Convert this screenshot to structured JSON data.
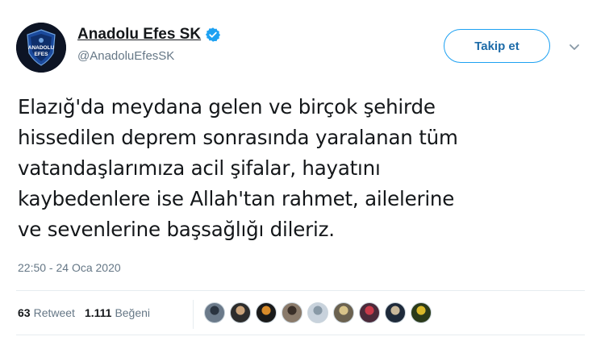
{
  "account": {
    "display_name": "Anadolu Efes SK",
    "handle": "@AnadoluEfesSK",
    "verified_icon": "verified-badge-icon",
    "avatar_logo_text": "ANADOLU EFES",
    "brand_color": "#1b4a9c"
  },
  "actions": {
    "follow_label": "Takip et",
    "more_icon": "chevron-down-icon"
  },
  "tweet": {
    "lines": [
      "Elazığ'da meydana gelen ve birçok şehirde",
      "hissedilen deprem sonrasında yaralanan tüm",
      "vatandaşlarımıza acil şifalar, hayatını",
      "kaybedenlere ise Allah'tan rahmet, ailelerine",
      "ve sevenlerine başsağlığı dileriz."
    ],
    "timestamp": "22:50 - 24 Oca 2020"
  },
  "stats": {
    "retweets_count": "63",
    "retweets_label": "Retweet",
    "likes_count": "1.111",
    "likes_label": "Beğeni"
  },
  "likers": [
    {
      "color": "#6b7a8a",
      "accent": "#2a3440"
    },
    {
      "color": "#2c2c2c",
      "accent": "#c9a27a"
    },
    {
      "color": "#1a1a1a",
      "accent": "#d88b2a"
    },
    {
      "color": "#8a7a6a",
      "accent": "#3a2f28"
    },
    {
      "color": "#c8d2dc",
      "accent": "#8899a6"
    },
    {
      "color": "#6b6250",
      "accent": "#d8c48a"
    },
    {
      "color": "#4a2a3a",
      "accent": "#c83a4a"
    },
    {
      "color": "#1e2a3a",
      "accent": "#c8b89a"
    },
    {
      "color": "#2a3a1a",
      "accent": "#d8b82a"
    }
  ]
}
